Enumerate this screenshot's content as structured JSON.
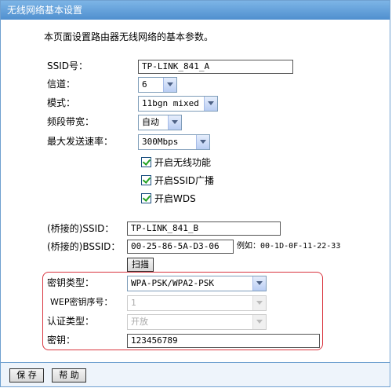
{
  "window": {
    "title": "无线网络基本设置"
  },
  "description": "本页面设置路由器无线网络的基本参数。",
  "fields": {
    "ssid": {
      "label": "SSID号：",
      "value": "TP-LINK_841_A"
    },
    "channel": {
      "label": "信道：",
      "value": "6"
    },
    "mode": {
      "label": "模式：",
      "value": "11bgn mixed"
    },
    "bandwidth": {
      "label": "频段带宽：",
      "value": "自动"
    },
    "max_rate": {
      "label": "最大发送速率：",
      "value": "300Mbps"
    }
  },
  "checkboxes": {
    "enable_wireless": {
      "label": "开启无线功能",
      "checked": true
    },
    "ssid_broadcast": {
      "label": "开启SSID广播",
      "checked": true
    },
    "wds": {
      "label": "开启WDS",
      "checked": true
    }
  },
  "bridge": {
    "ssid": {
      "label": "(桥接的)SSID：",
      "value": "TP-LINK_841_B"
    },
    "bssid": {
      "label": "(桥接的)BSSID：",
      "value": "00-25-86-5A-D3-06",
      "example": "例如：00-1D-0F-11-22-33"
    },
    "scan_label": "扫描"
  },
  "security": {
    "key_type": {
      "label": "密钥类型：",
      "value": "WPA-PSK/WPA2-PSK"
    },
    "wep_index": {
      "label": "WEP密钥序号：",
      "value": "1"
    },
    "auth_type": {
      "label": "认证类型：",
      "value": "开放"
    },
    "key": {
      "label": "密钥：",
      "value": "123456789"
    }
  },
  "footer": {
    "save_label": "保 存",
    "help_label": "帮 助"
  },
  "colors": {
    "titlebar": "#5b9ad6",
    "highlight_border": "#d9353f",
    "check": "#21a121"
  }
}
